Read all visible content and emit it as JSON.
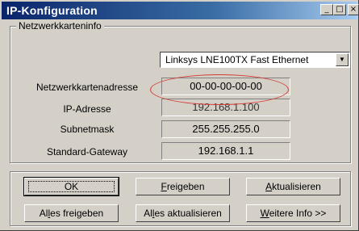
{
  "window": {
    "title": "IP-Konfiguration",
    "controls": {
      "minimize": "_",
      "maximize": "□",
      "close": "×"
    }
  },
  "group": {
    "legend": "Netzwerkkarteninfo"
  },
  "adapter": {
    "selected": "Linksys LNE100TX Fast Ethernet",
    "arrow": "▼"
  },
  "fields": [
    {
      "label": "Netzwerkkartenadresse",
      "value": "00-00-00-00-00"
    },
    {
      "label": "IP-Adresse",
      "value": "192.168.1.100"
    },
    {
      "label": "Subnetmask",
      "value": "255.255.255.0"
    },
    {
      "label": "Standard-Gateway",
      "value": "192.168.1.1"
    }
  ],
  "buttons": {
    "ok": {
      "label": "OK"
    },
    "freigeben": {
      "u": "F",
      "rest": "reigeben"
    },
    "aktualisieren": {
      "u": "A",
      "rest": "ktualisieren"
    },
    "alles_freigeben": {
      "pre": "Al",
      "u": "l",
      "rest": "es freigeben"
    },
    "alles_aktualisieren": {
      "pre": "Al",
      "u": "l",
      "rest": "es aktualisieren"
    },
    "weitere_info": {
      "u": "W",
      "rest": "eitere Info >>"
    }
  },
  "colors": {
    "title_gradient_start": "#0a246a",
    "title_gradient_end": "#a6caf0",
    "window_face": "#d4d0c8",
    "highlight_ellipse": "#d43c32"
  }
}
